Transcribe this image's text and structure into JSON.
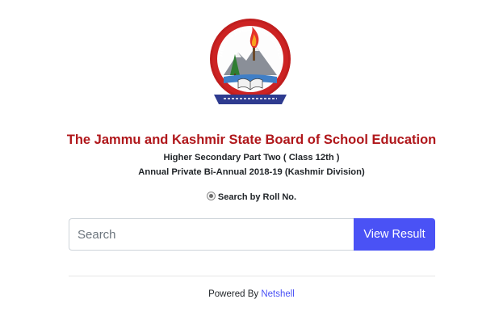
{
  "header": {
    "logo_text": "Jammu & Kashmir State Board Of School Education",
    "title": "The Jammu and Kashmir State Board of School Education",
    "subtitle_line1": "Higher Secondary Part Two ( Class 12th )",
    "subtitle_line2": "Annual Private Bi-Annual 2018-19 (Kashmir Division)"
  },
  "search": {
    "option_label": "Search by Roll No.",
    "option_selected": true,
    "placeholder": "Search",
    "value": "",
    "button_label": "View Result"
  },
  "footer": {
    "powered_by": "Powered By ",
    "link_text": "Netshell"
  },
  "colors": {
    "title": "#b0171b",
    "accent": "#4a52f5"
  }
}
